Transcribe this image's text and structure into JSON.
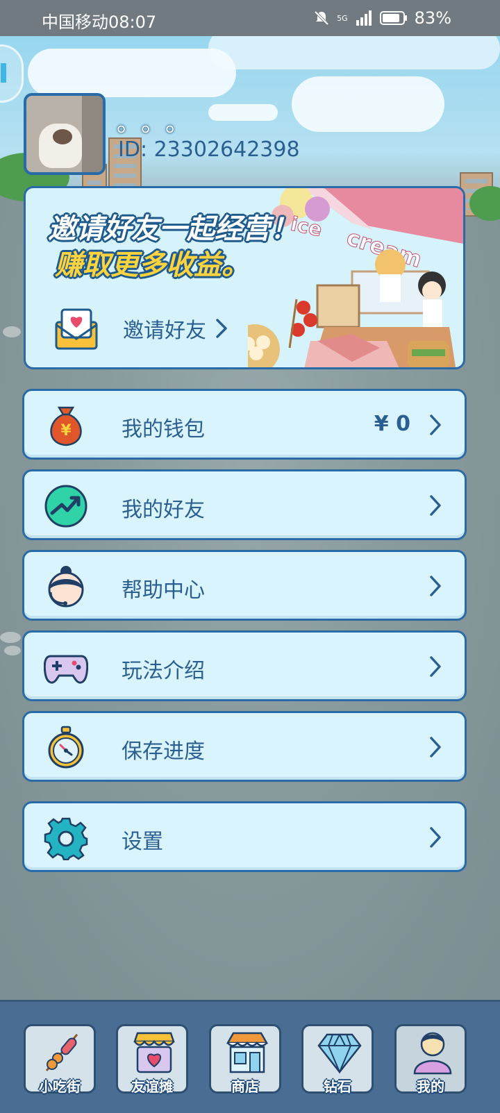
{
  "status_bar": {
    "carrier": "中国移动",
    "time": "08:07",
    "network": "5G",
    "battery": "83%"
  },
  "profile": {
    "nickname": "。。。",
    "id_text": "ID: 23302642398"
  },
  "invite_card": {
    "headline": "邀请好友一起经营！",
    "subline": "赚取更多收益。",
    "link_label": "邀请好友",
    "banner_words": "ice cream"
  },
  "menu": {
    "wallet": {
      "label": "我的钱包",
      "value": "¥ 0"
    },
    "friends": {
      "label": "我的好友"
    },
    "help": {
      "label": "帮助中心"
    },
    "guide": {
      "label": "玩法介绍"
    },
    "save": {
      "label": "保存进度"
    },
    "settings": {
      "label": "设置"
    }
  },
  "bottom_nav": [
    {
      "label": "小吃街",
      "icon": "skewer-icon"
    },
    {
      "label": "友谊摊",
      "icon": "heart-stall-icon"
    },
    {
      "label": "商店",
      "icon": "shop-icon"
    },
    {
      "label": "钻石",
      "icon": "diamond-icon"
    },
    {
      "label": "我的",
      "icon": "person-icon"
    }
  ],
  "colors": {
    "accent": "#2a6aa6",
    "card_bg": "#d9f4fc",
    "text": "#2c5f91",
    "gold": "#ffd33d"
  }
}
